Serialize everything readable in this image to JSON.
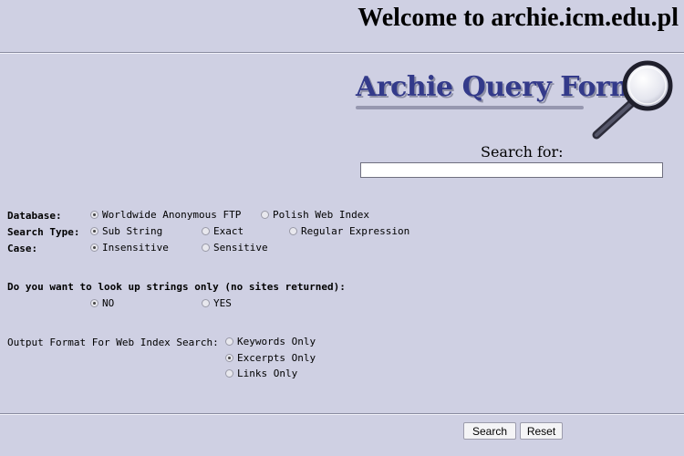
{
  "colors": {
    "background": "#cfd0e3",
    "logo_text": "#333a8a"
  },
  "header": {
    "title": "Welcome to archie.icm.edu.pl"
  },
  "logo": {
    "text": "Archie Query Form",
    "icon": "magnifying-glass-icon"
  },
  "search": {
    "label": "Search for:",
    "value": ""
  },
  "database": {
    "label": "Database:",
    "options": [
      {
        "label": "Worldwide Anonymous FTP",
        "checked": true
      },
      {
        "label": "Polish Web Index",
        "checked": false
      }
    ]
  },
  "search_type": {
    "label": "Search Type:",
    "options": [
      {
        "label": "Sub String",
        "checked": true
      },
      {
        "label": "Exact",
        "checked": false
      },
      {
        "label": "Regular Expression",
        "checked": false
      }
    ]
  },
  "case": {
    "label": "Case:",
    "options": [
      {
        "label": "Insensitive",
        "checked": true
      },
      {
        "label": "Sensitive",
        "checked": false
      }
    ]
  },
  "strings_only": {
    "label": "Do you want to look up strings only (no sites returned):",
    "options": [
      {
        "label": "NO",
        "checked": true
      },
      {
        "label": "YES",
        "checked": false
      }
    ]
  },
  "output_format": {
    "label": "Output Format For Web Index Search:",
    "options": [
      {
        "label": "Keywords Only",
        "checked": false
      },
      {
        "label": "Excerpts Only",
        "checked": true
      },
      {
        "label": "Links Only",
        "checked": false
      }
    ]
  },
  "buttons": {
    "search_label": "Search",
    "reset_label": "Reset"
  }
}
